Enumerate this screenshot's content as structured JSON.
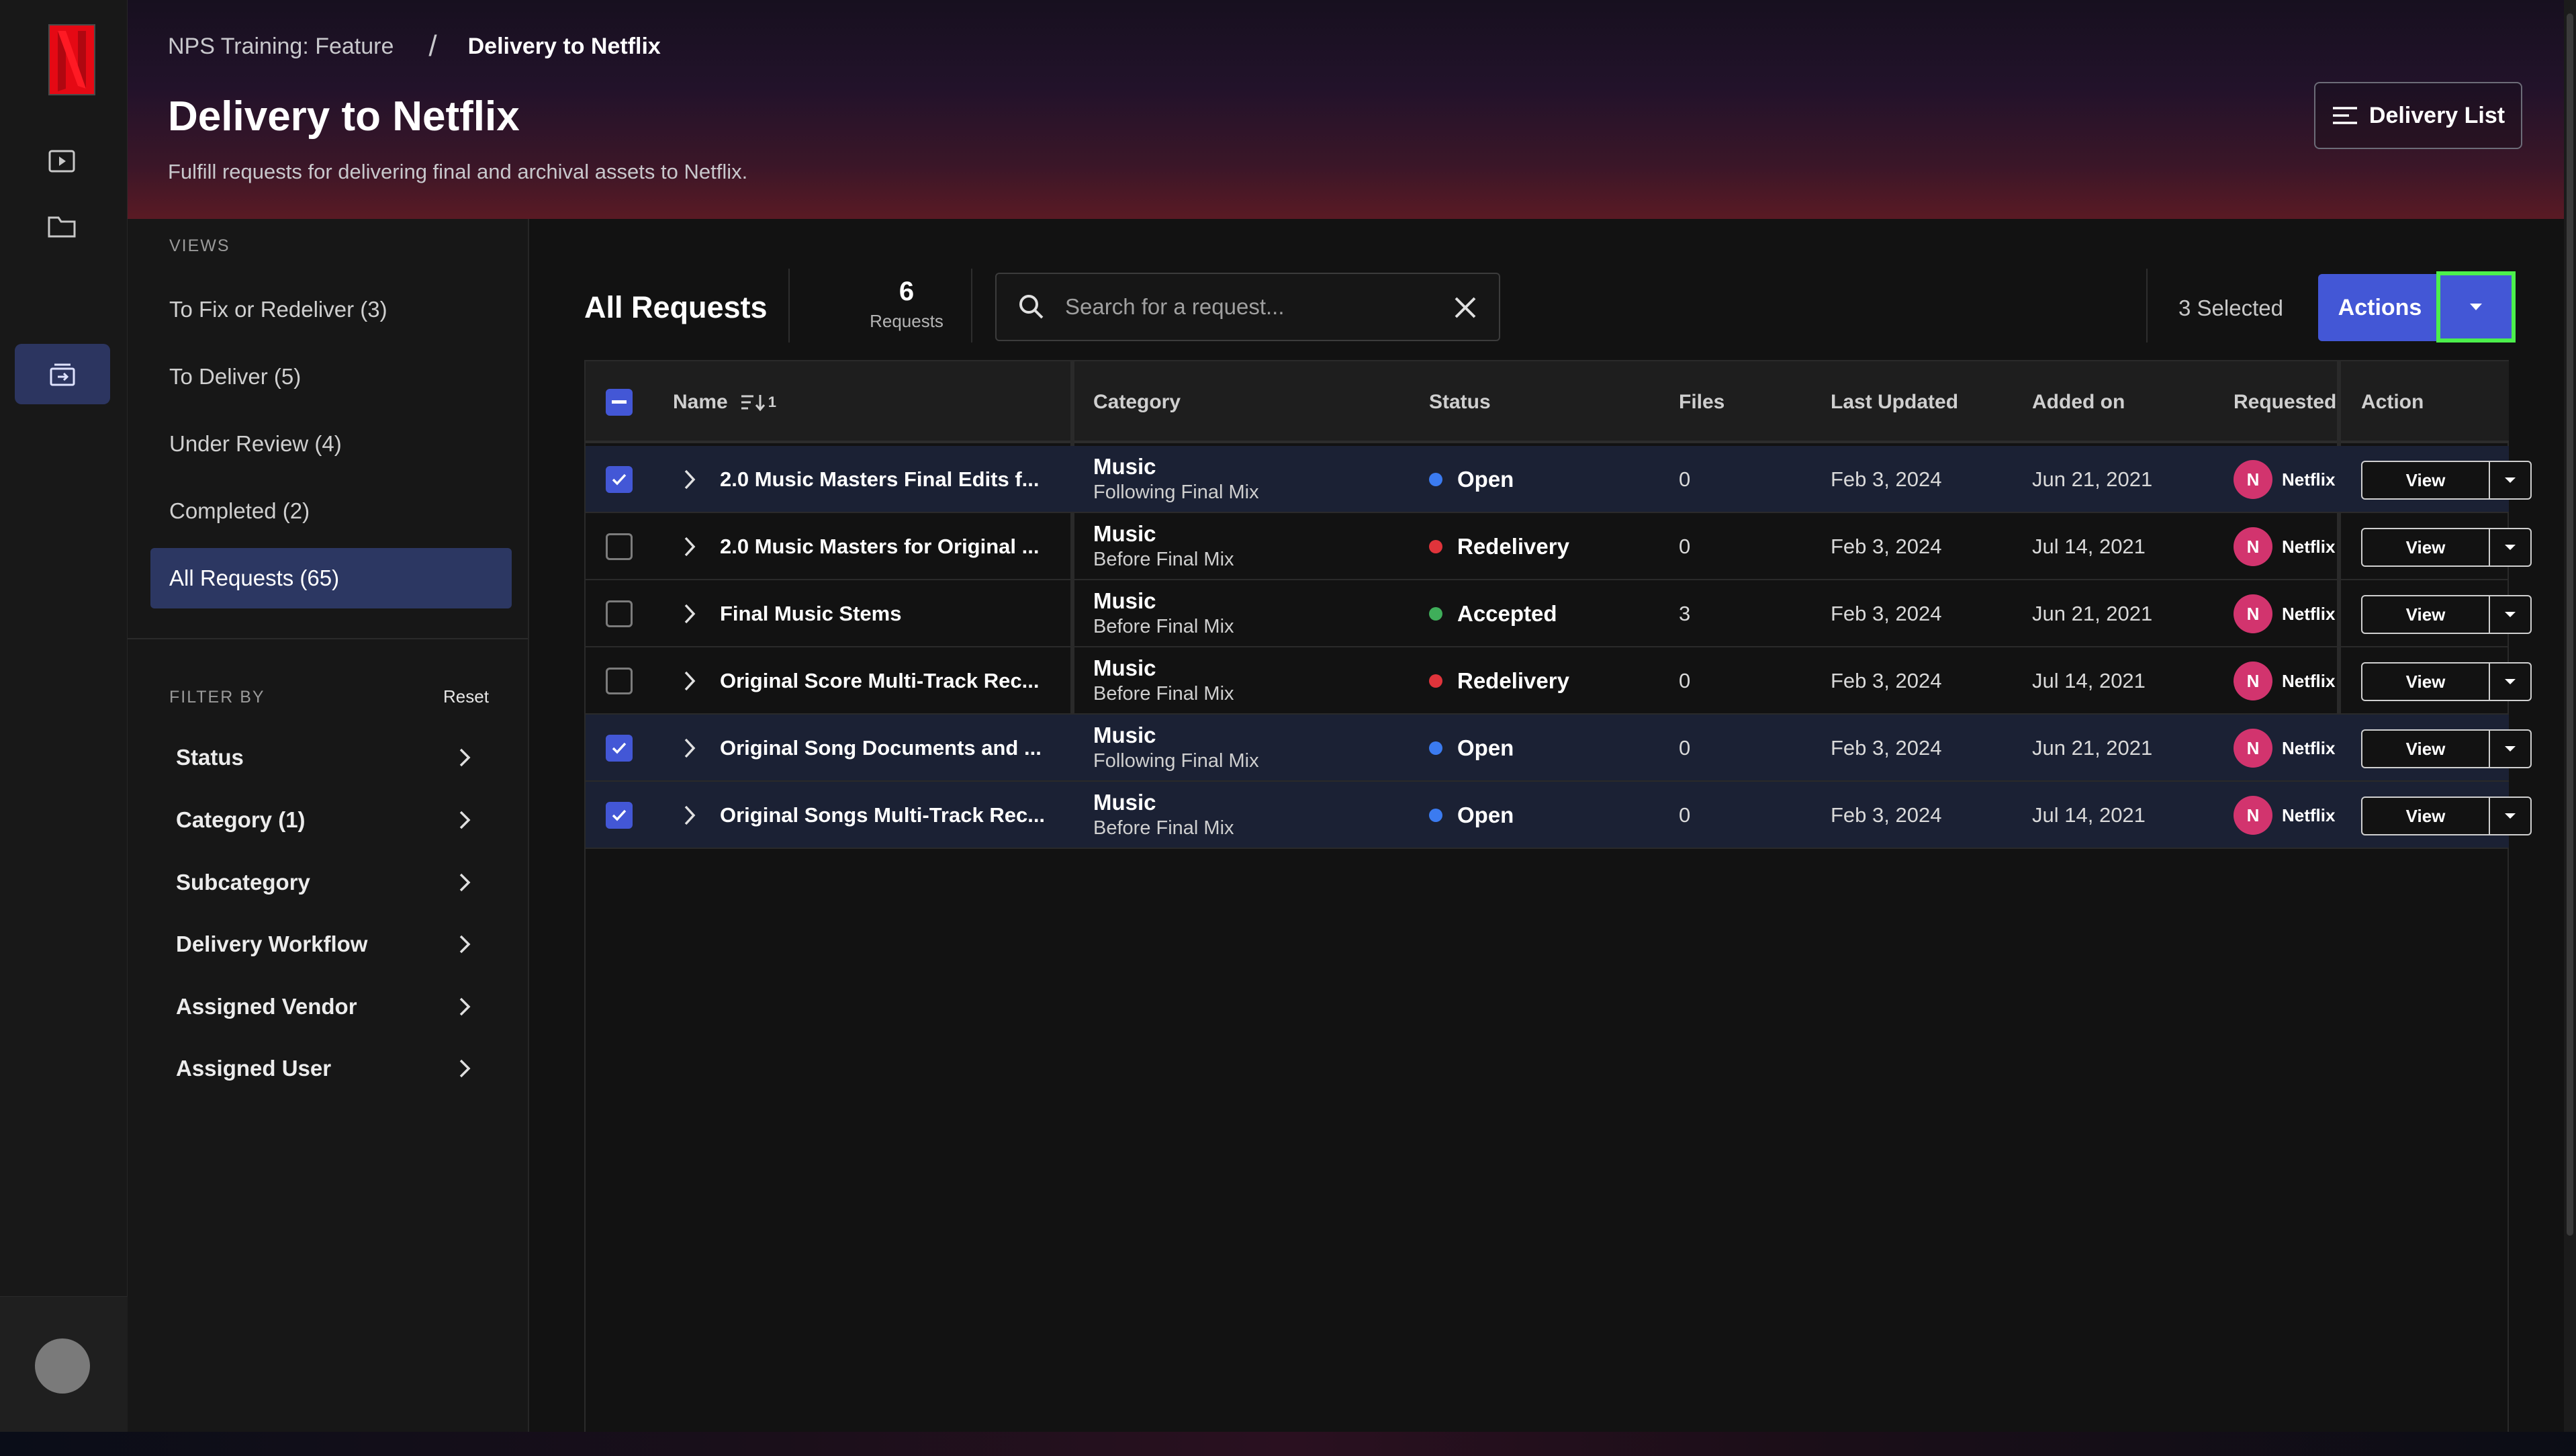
{
  "breadcrumb": {
    "parent": "NPS Training: Feature",
    "separator": "/",
    "current": "Delivery to Netflix"
  },
  "header": {
    "title": "Delivery to Netflix",
    "subtitle": "Fulfill requests for delivering final and archival assets to Netflix.",
    "delivery_list_label": "Delivery List"
  },
  "views": {
    "section_label": "VIEWS",
    "items": [
      {
        "label": "To Fix or Redeliver (3)"
      },
      {
        "label": "To Deliver (5)"
      },
      {
        "label": "Under Review (4)"
      },
      {
        "label": "Completed (2)"
      },
      {
        "label": "All Requests (65)"
      }
    ]
  },
  "filters": {
    "section_label": "FILTER BY",
    "reset_label": "Reset",
    "items": [
      {
        "label": "Status"
      },
      {
        "label": "Category (1)"
      },
      {
        "label": "Subcategory"
      },
      {
        "label": "Delivery Workflow"
      },
      {
        "label": "Assigned Vendor"
      },
      {
        "label": "Assigned User"
      }
    ]
  },
  "toolbar": {
    "title": "All Requests",
    "count": "6",
    "count_label": "Requests",
    "search_placeholder": "Search for a request...",
    "selected_label": "3 Selected",
    "actions_label": "Actions"
  },
  "table": {
    "headers": {
      "name": "Name",
      "sort_badge": "1",
      "category": "Category",
      "status": "Status",
      "files": "Files",
      "last_updated": "Last Updated",
      "added_on": "Added on",
      "requested": "Requested",
      "action": "Action"
    },
    "view_label": "View",
    "rows": [
      {
        "selected": true,
        "name": "2.0 Music Masters Final Edits f...",
        "category": "Music",
        "subcategory": "Following Final Mix",
        "status": "Open",
        "status_color": "#3b7bf0",
        "files": "0",
        "last_updated": "Feb 3, 2024",
        "added_on": "Jun 21, 2021",
        "requester_initial": "N",
        "requester": "Netflix"
      },
      {
        "selected": false,
        "name": "2.0 Music Masters for Original ...",
        "category": "Music",
        "subcategory": "Before Final Mix",
        "status": "Redelivery",
        "status_color": "#e0343b",
        "files": "0",
        "last_updated": "Feb 3, 2024",
        "added_on": "Jul 14, 2021",
        "requester_initial": "N",
        "requester": "Netflix"
      },
      {
        "selected": false,
        "name": "Final Music Stems",
        "category": "Music",
        "subcategory": "Before Final Mix",
        "status": "Accepted",
        "status_color": "#3fae5a",
        "files": "3",
        "last_updated": "Feb 3, 2024",
        "added_on": "Jun 21, 2021",
        "requester_initial": "N",
        "requester": "Netflix"
      },
      {
        "selected": false,
        "name": "Original Score Multi-Track Rec...",
        "category": "Music",
        "subcategory": "Before Final Mix",
        "status": "Redelivery",
        "status_color": "#e0343b",
        "files": "0",
        "last_updated": "Feb 3, 2024",
        "added_on": "Jul 14, 2021",
        "requester_initial": "N",
        "requester": "Netflix"
      },
      {
        "selected": true,
        "name": "Original Song Documents and ...",
        "category": "Music",
        "subcategory": "Following Final Mix",
        "status": "Open",
        "status_color": "#3b7bf0",
        "files": "0",
        "last_updated": "Feb 3, 2024",
        "added_on": "Jun 21, 2021",
        "requester_initial": "N",
        "requester": "Netflix"
      },
      {
        "selected": true,
        "name": "Original Songs Multi-Track Rec...",
        "category": "Music",
        "subcategory": "Before Final Mix",
        "status": "Open",
        "status_color": "#3b7bf0",
        "files": "0",
        "last_updated": "Feb 3, 2024",
        "added_on": "Jul 14, 2021",
        "requester_initial": "N",
        "requester": "Netflix"
      }
    ]
  },
  "colors": {
    "accent": "#4357d6",
    "highlight": "#4cf04c",
    "brand": "#e50914"
  }
}
